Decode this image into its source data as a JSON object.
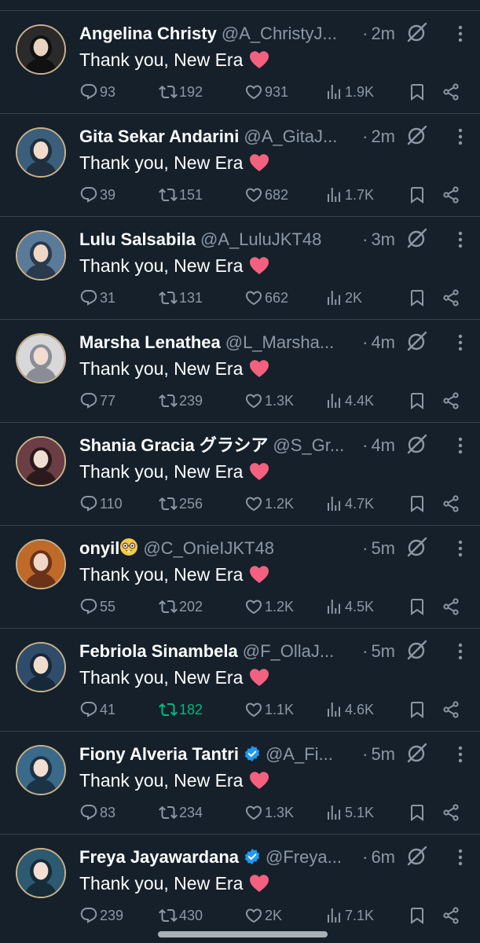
{
  "colors": {
    "background": "#15202b",
    "divider": "#38444d",
    "secondary_text": "#8b98a5",
    "retweet_active": "#00ba7c",
    "heart_emoji": "#f4617f",
    "verified_badge": "#1d9bf0"
  },
  "icons": {
    "reply": "reply-icon",
    "retweet": "retweet-icon",
    "like": "like-icon",
    "views": "views-icon",
    "bookmark": "bookmark-icon",
    "share": "share-icon",
    "grok": "grok-icon",
    "more": "more-icon",
    "verified": "verified-badge-icon",
    "emoji": "heart-emoji-icon",
    "face_emoji": "nerd-face-emoji-icon"
  },
  "tweets": [
    {
      "name": "Angelina Christy",
      "handle": "@A_ChristyJ...",
      "time": "2m",
      "text": "Thank you, New Era",
      "replies": "93",
      "retweets": "192",
      "likes": "931",
      "views": "1.9K",
      "verified": false,
      "retweeted": false
    },
    {
      "name": "Gita Sekar Andarini",
      "handle": "@A_GitaJ...",
      "time": "2m",
      "text": "Thank you, New Era",
      "replies": "39",
      "retweets": "151",
      "likes": "682",
      "views": "1.7K",
      "verified": false,
      "retweeted": false
    },
    {
      "name": "Lulu Salsabila",
      "handle": "@A_LuluJKT48",
      "time": "3m",
      "text": "Thank you, New Era",
      "replies": "31",
      "retweets": "131",
      "likes": "662",
      "views": "2K",
      "verified": false,
      "retweeted": false
    },
    {
      "name": "Marsha Lenathea",
      "handle": "@L_Marsha...",
      "time": "4m",
      "text": "Thank you, New Era",
      "replies": "77",
      "retweets": "239",
      "likes": "1.3K",
      "views": "4.4K",
      "verified": false,
      "retweeted": false
    },
    {
      "name": "Shania Gracia グラシア",
      "handle": "@S_Gr...",
      "time": "4m",
      "text": "Thank you, New Era",
      "replies": "110",
      "retweets": "256",
      "likes": "1.2K",
      "views": "4.7K",
      "verified": false,
      "retweeted": false
    },
    {
      "name": "onyil",
      "handle": "@C_OnieIJKT48",
      "time": "5m",
      "text": "Thank you, New Era",
      "replies": "55",
      "retweets": "202",
      "likes": "1.2K",
      "views": "4.5K",
      "verified": false,
      "retweeted": false,
      "name_emoji": true
    },
    {
      "name": "Febriola Sinambela",
      "handle": "@F_OllaJ...",
      "time": "5m",
      "text": "Thank you, New Era",
      "replies": "41",
      "retweets": "182",
      "likes": "1.1K",
      "views": "4.6K",
      "verified": false,
      "retweeted": true
    },
    {
      "name": "Fiony Alveria Tantri",
      "handle": "@A_Fi...",
      "time": "5m",
      "text": "Thank you, New Era",
      "replies": "83",
      "retweets": "234",
      "likes": "1.3K",
      "views": "5.1K",
      "verified": true,
      "retweeted": false
    },
    {
      "name": "Freya Jayawardana",
      "handle": "@Freya...",
      "time": "6m",
      "text": "Thank you, New Era",
      "replies": "239",
      "retweets": "430",
      "likes": "2K",
      "views": "7.1K",
      "verified": true,
      "retweeted": false
    }
  ]
}
